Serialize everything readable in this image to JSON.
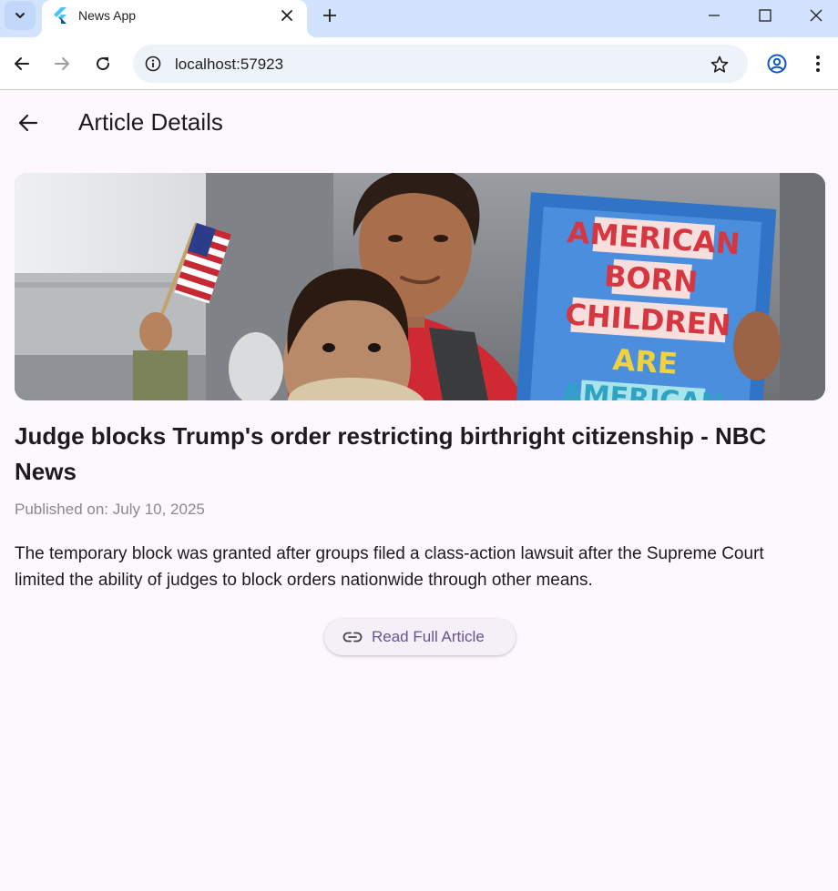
{
  "browser": {
    "tab_title": "News App",
    "url": "localhost:57923"
  },
  "colors": {
    "page_background": "#fdf7fe",
    "tabstrip": "#d3e3fd",
    "button_text": "#65558f",
    "button_background": "#f5eff7"
  },
  "icons": {
    "tab_search": "chevron-down-icon",
    "favicon": "flutter-icon",
    "tab_close": "close-icon",
    "new_tab": "plus-icon",
    "minimize": "minimize-icon",
    "maximize": "maximize-icon",
    "close_window": "close-icon",
    "back": "arrow-left-icon",
    "forward": "arrow-right-icon",
    "reload": "reload-icon",
    "site_info": "info-icon",
    "bookmark": "star-icon",
    "profile": "profile-icon",
    "menu": "kebab-menu-icon",
    "app_back": "arrow-left-icon",
    "link": "link-icon"
  },
  "app": {
    "title": "Article Details",
    "sign_lines": [
      "AMERICAN",
      "BORN",
      "CHILDREN",
      "ARE",
      "AMERICAN"
    ]
  },
  "article": {
    "headline": "Judge blocks Trump's order restricting birthright citizenship - NBC News",
    "published": "Published on: July 10, 2025",
    "description": "The temporary block was granted after groups filed a class-action lawsuit after the Supreme Court limited the ability of judges to block orders nationwide through other means.",
    "button_label": "Read Full Article"
  }
}
